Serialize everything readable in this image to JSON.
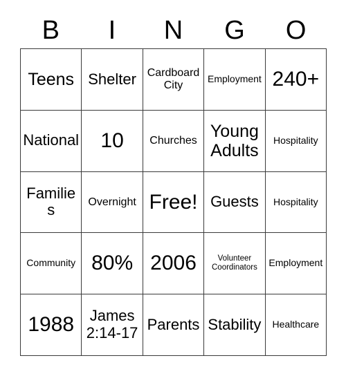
{
  "card": {
    "title": "Bingo Card",
    "header_letters": [
      "B",
      "I",
      "N",
      "G",
      "O"
    ],
    "columns": 5,
    "rows": 5,
    "free_space": {
      "row": 2,
      "col": 2,
      "label": "Free!"
    },
    "colors": {
      "background": "#ffffff",
      "text": "#000000",
      "grid_line": "#3a3a3a"
    },
    "grid": [
      [
        {
          "text": "Teens",
          "size": "lg"
        },
        {
          "text": "Shelter",
          "size": "md"
        },
        {
          "text": "Cardboard City",
          "size": "sm"
        },
        {
          "text": "Employment",
          "size": "xs"
        },
        {
          "text": "240+",
          "size": "xl"
        }
      ],
      [
        {
          "text": "National",
          "size": "md"
        },
        {
          "text": "10",
          "size": "xl"
        },
        {
          "text": "Churches",
          "size": "sm"
        },
        {
          "text": "Young Adults",
          "size": "lg"
        },
        {
          "text": "Hospitality",
          "size": "xs"
        }
      ],
      [
        {
          "text": "Families",
          "size": "md"
        },
        {
          "text": "Overnight",
          "size": "sm"
        },
        {
          "text": "Free!",
          "size": "xl"
        },
        {
          "text": "Guests",
          "size": "md"
        },
        {
          "text": "Hospitality",
          "size": "xs"
        }
      ],
      [
        {
          "text": "Community",
          "size": "xs"
        },
        {
          "text": "80%",
          "size": "xl"
        },
        {
          "text": "2006",
          "size": "xl"
        },
        {
          "text": "Volunteer Coordinators",
          "size": "xxs"
        },
        {
          "text": "Employment",
          "size": "xs"
        }
      ],
      [
        {
          "text": "1988",
          "size": "xl"
        },
        {
          "text": "James 2:14-17",
          "size": "md"
        },
        {
          "text": "Parents",
          "size": "md"
        },
        {
          "text": "Stability",
          "size": "md"
        },
        {
          "text": "Healthcare",
          "size": "xs"
        }
      ]
    ]
  }
}
